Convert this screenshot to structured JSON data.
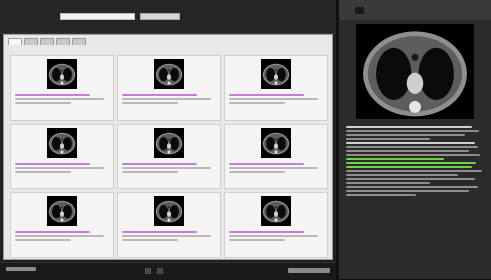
{
  "search": {
    "query": "",
    "button_label": ""
  },
  "tabs": [
    {
      "label": "",
      "active": true
    },
    {
      "label": "",
      "active": false
    },
    {
      "label": "",
      "active": false
    },
    {
      "label": "",
      "active": false
    },
    {
      "label": "",
      "active": false
    }
  ],
  "results": {
    "count_text": "",
    "items": [
      {
        "caption": ""
      },
      {
        "caption": ""
      },
      {
        "caption": ""
      },
      {
        "caption": ""
      },
      {
        "caption": ""
      },
      {
        "caption": ""
      },
      {
        "caption": ""
      },
      {
        "caption": ""
      },
      {
        "caption": ""
      }
    ]
  },
  "footer": {
    "left_logo": "",
    "right_logo": "",
    "pager_label": "",
    "prev_glyph": "‹",
    "next_glyph": "›"
  },
  "detail": {
    "badge": "",
    "description": ""
  },
  "colors": {
    "highlight": "#c77ad8",
    "accent_green": "#6fcf45",
    "panel_bg": "#e8e8e8",
    "sidebar_bg": "#2b2b2b"
  },
  "icons": {
    "thumbnail": "ct-thumbnail-icon",
    "detail": "ct-scan-image-icon"
  }
}
